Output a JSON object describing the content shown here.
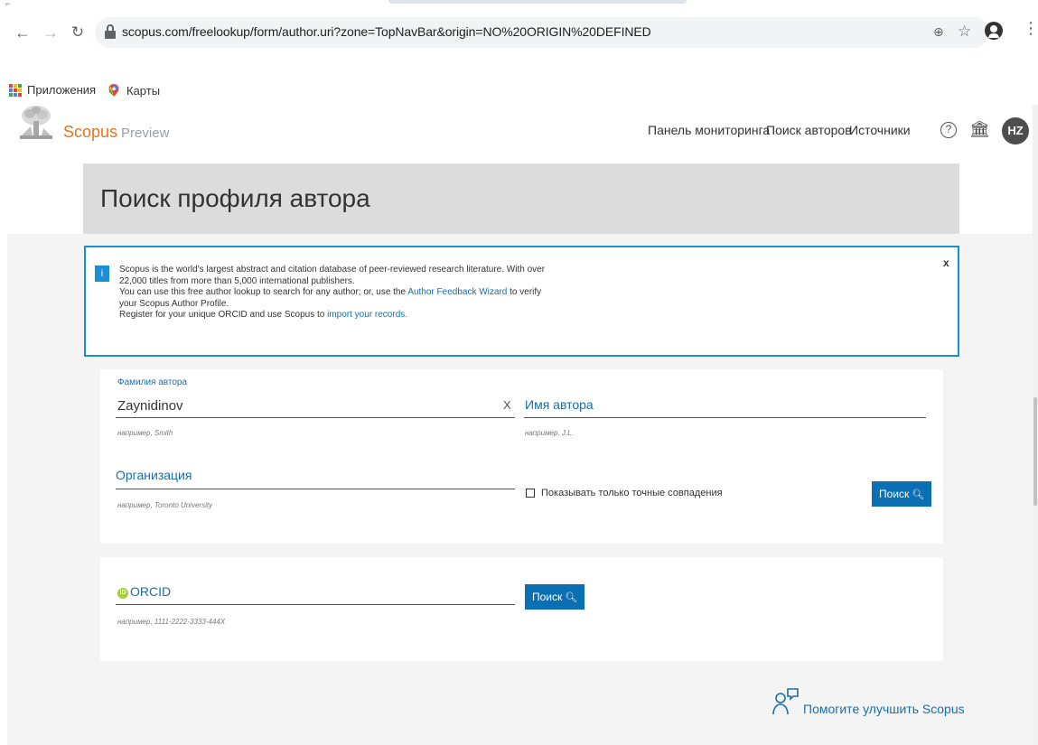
{
  "browser": {
    "url": "scopus.com/freelookup/form/author.uri?zone=TopNavBar&origin=NO%20ORIGIN%20DEFINED",
    "bookmarks": [
      {
        "label": "Приложения",
        "icon": "apps-grid-icon"
      },
      {
        "label": "Карты",
        "icon": "google-maps-icon"
      }
    ]
  },
  "header": {
    "brand": "Scopus",
    "brand_sub": "Preview",
    "nav": [
      "Панель мониторинга",
      "Поиск авторов",
      "Источники"
    ],
    "avatar_initials": "HZ",
    "brand_color": "#e9711c"
  },
  "page": {
    "title": "Поиск профиля автора"
  },
  "info": {
    "badge": "i",
    "line1": "Scopus is the world's largest abstract and citation database of peer-reviewed research literature. With over",
    "line2": "22,000 titles from more than 5,000 international publishers.",
    "line3_pre": "You can use this free author lookup to search for any author; or, use the ",
    "line3_link": "Author Feedback Wizard",
    "line3_post": " to verify",
    "line4": "your Scopus Author Profile.",
    "line5_pre": "Register for your unique ORCID and use Scopus to ",
    "line5_link": "import your records.",
    "close": "x"
  },
  "form": {
    "lastname_label": "Фамилия автора",
    "lastname_value": "Zaynidinov",
    "lastname_hint": "например, Smith",
    "clear": "X",
    "firstname_placeholder": "Имя автора",
    "firstname_hint": "например, J.L.",
    "affiliation_placeholder": "Организация",
    "affiliation_hint": "например, Toronto University",
    "exact_match_label": "Показывать только точные совпадения",
    "search_button": "Поиск"
  },
  "orcid": {
    "badge": "iD",
    "placeholder": "ORCID",
    "hint": "например, 1111-2222-3333-444X",
    "search_button": "Поиск"
  },
  "feedback": {
    "label": "Помогите улучшить Scopus"
  }
}
